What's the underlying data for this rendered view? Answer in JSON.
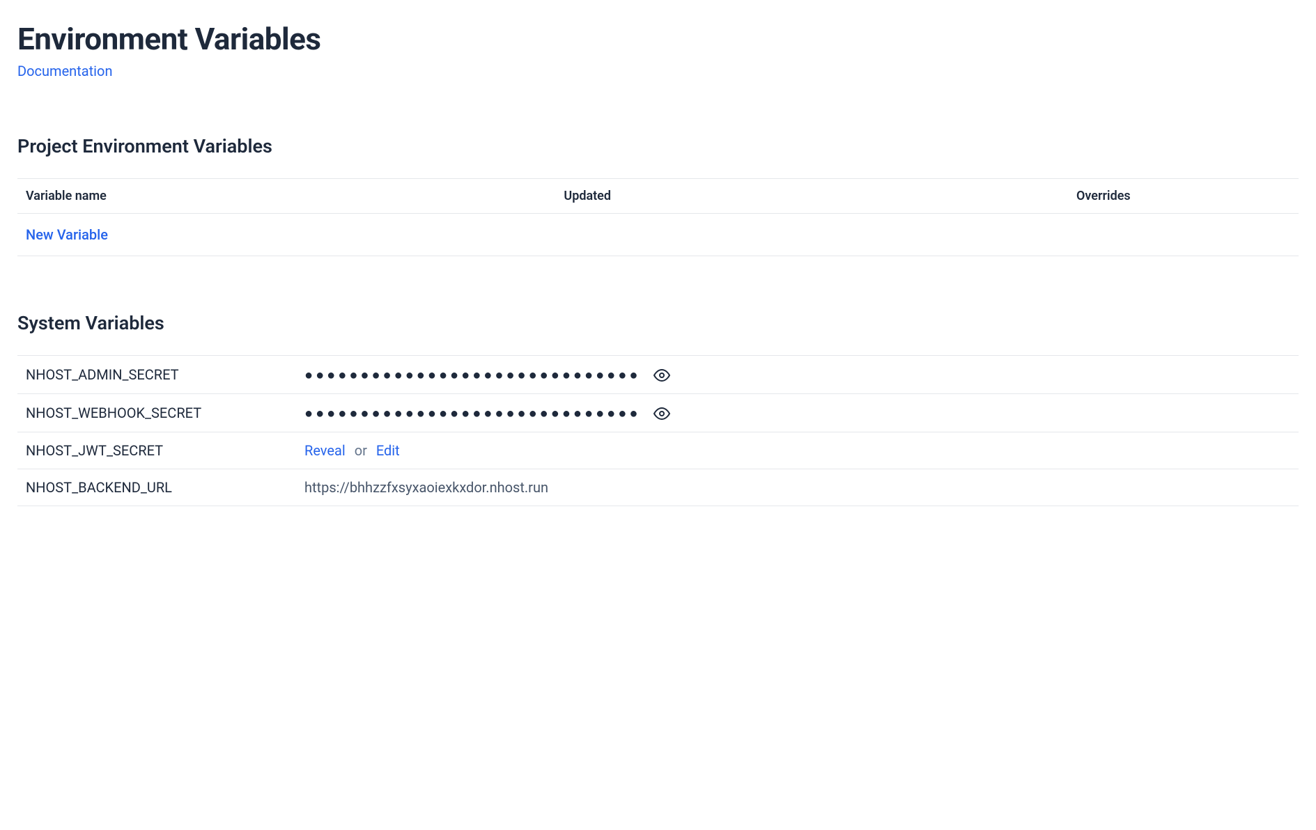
{
  "header": {
    "title": "Environment Variables",
    "doc_link_label": "Documentation"
  },
  "project_section": {
    "title": "Project Environment Variables",
    "columns": {
      "name": "Variable name",
      "updated": "Updated",
      "overrides": "Overrides"
    },
    "new_variable_label": "New Variable"
  },
  "system_section": {
    "title": "System Variables",
    "rows": [
      {
        "name": "NHOST_ADMIN_SECRET",
        "masked": "●●●●●●●●●●●●●●●●●●●●●●●●●●●●●●",
        "type": "masked"
      },
      {
        "name": "NHOST_WEBHOOK_SECRET",
        "masked": "●●●●●●●●●●●●●●●●●●●●●●●●●●●●●●",
        "type": "masked"
      },
      {
        "name": "NHOST_JWT_SECRET",
        "reveal_label": "Reveal",
        "or_label": "or",
        "edit_label": "Edit",
        "type": "actions"
      },
      {
        "name": "NHOST_BACKEND_URL",
        "value": "https://bhhzzfxsyxaoiexkxdor.nhost.run",
        "type": "plain"
      }
    ]
  }
}
